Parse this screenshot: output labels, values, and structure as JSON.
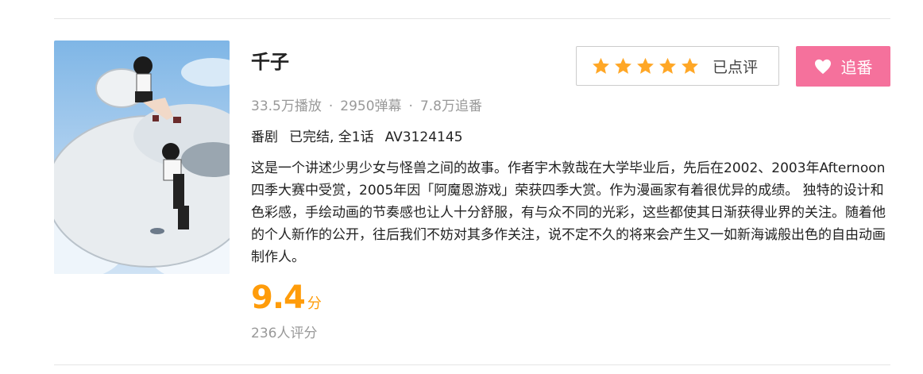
{
  "item": {
    "title": "千子",
    "stats": {
      "plays": "33.5万播放",
      "danmaku": "2950弹幕",
      "followers": "7.8万追番",
      "separator": "·"
    },
    "meta": {
      "type": "番剧",
      "status": "已完结, 全1话",
      "av": "AV3124145"
    },
    "description": "这是一个讲述少男少女与怪兽之间的故事。作者宇木敦哉在大学毕业后，先后在2002、2003年Afternoon四季大赛中受赏，2005年因「阿魔恩游戏」荣获四季大赏。作为漫画家有着很优异的成绩。 独特的设计和色彩感，手绘动画的节奏感也让人十分舒服，有与众不同的光彩，这些都使其日渐获得业界的关注。随着他的个人新作的公开，往后我们不妨对其多作关注，说不定不久的将来会产生又一如新海诚般出色的自由动画制作人。",
    "score": {
      "value": "9.4",
      "unit": "分",
      "count": "236人评分"
    },
    "review_button": {
      "stars": 5,
      "label": "已点评"
    },
    "follow_button": {
      "label": "追番",
      "icon": "heart-icon"
    }
  },
  "colors": {
    "accent_orange": "#ff9c0a",
    "star": "#ffa726",
    "follow_pink": "#f5719c",
    "muted_text": "#999999"
  }
}
